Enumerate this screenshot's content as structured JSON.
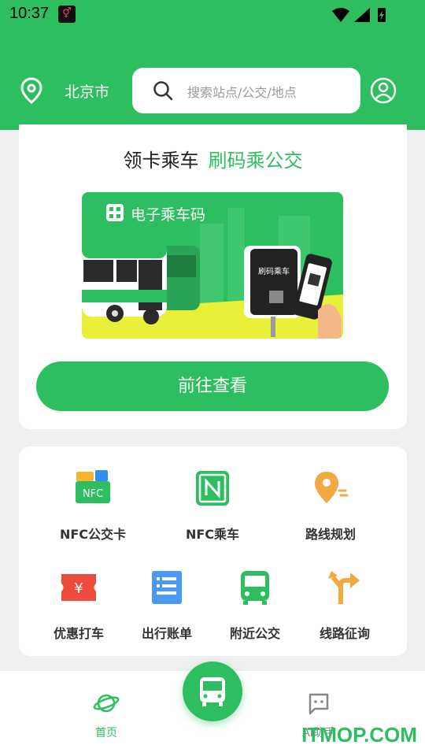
{
  "status_bar": {
    "time": "10:37"
  },
  "header": {
    "city": "北京市",
    "search_placeholder": "搜索站点/公交/地点",
    "colors": {
      "brand": "#2dbf5f"
    }
  },
  "promo": {
    "title_main": "领卡乘车",
    "title_accent": "刷码乘公交",
    "banner_label": "电子乘车码",
    "banner_device_text": "刷码乘车",
    "button_label": "前往查看"
  },
  "features": [
    {
      "label": "NFC公交卡",
      "icon": "nfc-card-icon"
    },
    {
      "label": "NFC乘车",
      "icon": "nfc-icon"
    },
    {
      "label": "路线规划",
      "icon": "route-plan-icon"
    },
    {
      "label": "优惠打车",
      "icon": "taxi-coupon-icon"
    },
    {
      "label": "出行账单",
      "icon": "bill-icon"
    },
    {
      "label": "附近公交",
      "icon": "nearby-bus-icon"
    },
    {
      "label": "线路征询",
      "icon": "route-survey-icon"
    }
  ],
  "bottom_nav": {
    "home_label": "首页",
    "ai_label": "AI助手"
  },
  "watermark": "ITMOP.COM"
}
